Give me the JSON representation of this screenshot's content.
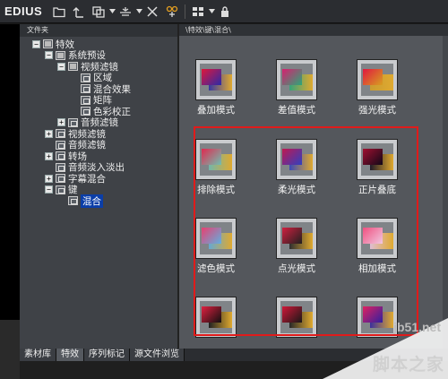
{
  "app": {
    "title": "EDIUS"
  },
  "toolbar": {
    "icons": [
      "folder-icon",
      "up-arrow-icon",
      "copy-icon",
      "cut-icon",
      "delete-icon",
      "effect-icon",
      "view-icon",
      "lock-icon"
    ]
  },
  "folder_panel": {
    "header": "文件夹",
    "tree": [
      {
        "label": "特效",
        "level": 0,
        "expander": "−",
        "icon": "folder"
      },
      {
        "label": "系统预设",
        "level": 1,
        "expander": "−",
        "icon": "folder"
      },
      {
        "label": "视频滤镜",
        "level": 2,
        "expander": "−",
        "icon": "folder"
      },
      {
        "label": "区域",
        "level": 3,
        "expander": "",
        "icon": "doc"
      },
      {
        "label": "混合效果",
        "level": 3,
        "expander": "",
        "icon": "doc"
      },
      {
        "label": "矩阵",
        "level": 3,
        "expander": "",
        "icon": "doc"
      },
      {
        "label": "色彩校正",
        "level": 3,
        "expander": "",
        "icon": "doc"
      },
      {
        "label": "音频滤镜",
        "level": 2,
        "expander": "+",
        "icon": "doc"
      },
      {
        "label": "视频滤镜",
        "level": 1,
        "expander": "+",
        "icon": "doc"
      },
      {
        "label": "音频滤镜",
        "level": 1,
        "expander": "",
        "icon": "doc"
      },
      {
        "label": "转场",
        "level": 1,
        "expander": "+",
        "icon": "doc"
      },
      {
        "label": "音频淡入淡出",
        "level": 1,
        "expander": "",
        "icon": "doc"
      },
      {
        "label": "字幕混合",
        "level": 1,
        "expander": "+",
        "icon": "doc"
      },
      {
        "label": "键",
        "level": 1,
        "expander": "−",
        "icon": "doc"
      },
      {
        "label": "混合",
        "level": 2,
        "expander": "",
        "icon": "doc",
        "selected": true
      }
    ]
  },
  "bottom_tabs": [
    "素材库",
    "特效",
    "序列标记",
    "源文件浏览"
  ],
  "path": "\\特效\\键\\混合\\",
  "effects": [
    {
      "label": "叠加模式",
      "a": "#e0163a",
      "b": "#2a2aa8"
    },
    {
      "label": "差值模式",
      "a": "#d82070",
      "b": "#2aa878"
    },
    {
      "label": "强光模式",
      "a": "#e01840",
      "b": "#d8a020"
    },
    {
      "label": "排除模式",
      "a": "#e02a50",
      "b": "#70c0b0"
    },
    {
      "label": "柔光模式",
      "a": "#c01850",
      "b": "#3040c0"
    },
    {
      "label": "正片叠底",
      "a": "#a01030",
      "b": "#100818"
    },
    {
      "label": "滤色模式",
      "a": "#e84070",
      "b": "#60b0e0"
    },
    {
      "label": "点光模式",
      "a": "#d02040",
      "b": "#202020"
    },
    {
      "label": "相加模式",
      "a": "#f05080",
      "b": "#f0c8e0"
    },
    {
      "label": "",
      "a": "#e02040",
      "b": "#101010"
    },
    {
      "label": "",
      "a": "#d01838",
      "b": "#181818"
    },
    {
      "label": "",
      "a": "#e02060",
      "b": "#3020a0"
    }
  ],
  "watermark": {
    "url": "jb51.net",
    "text": "脚本之家"
  }
}
